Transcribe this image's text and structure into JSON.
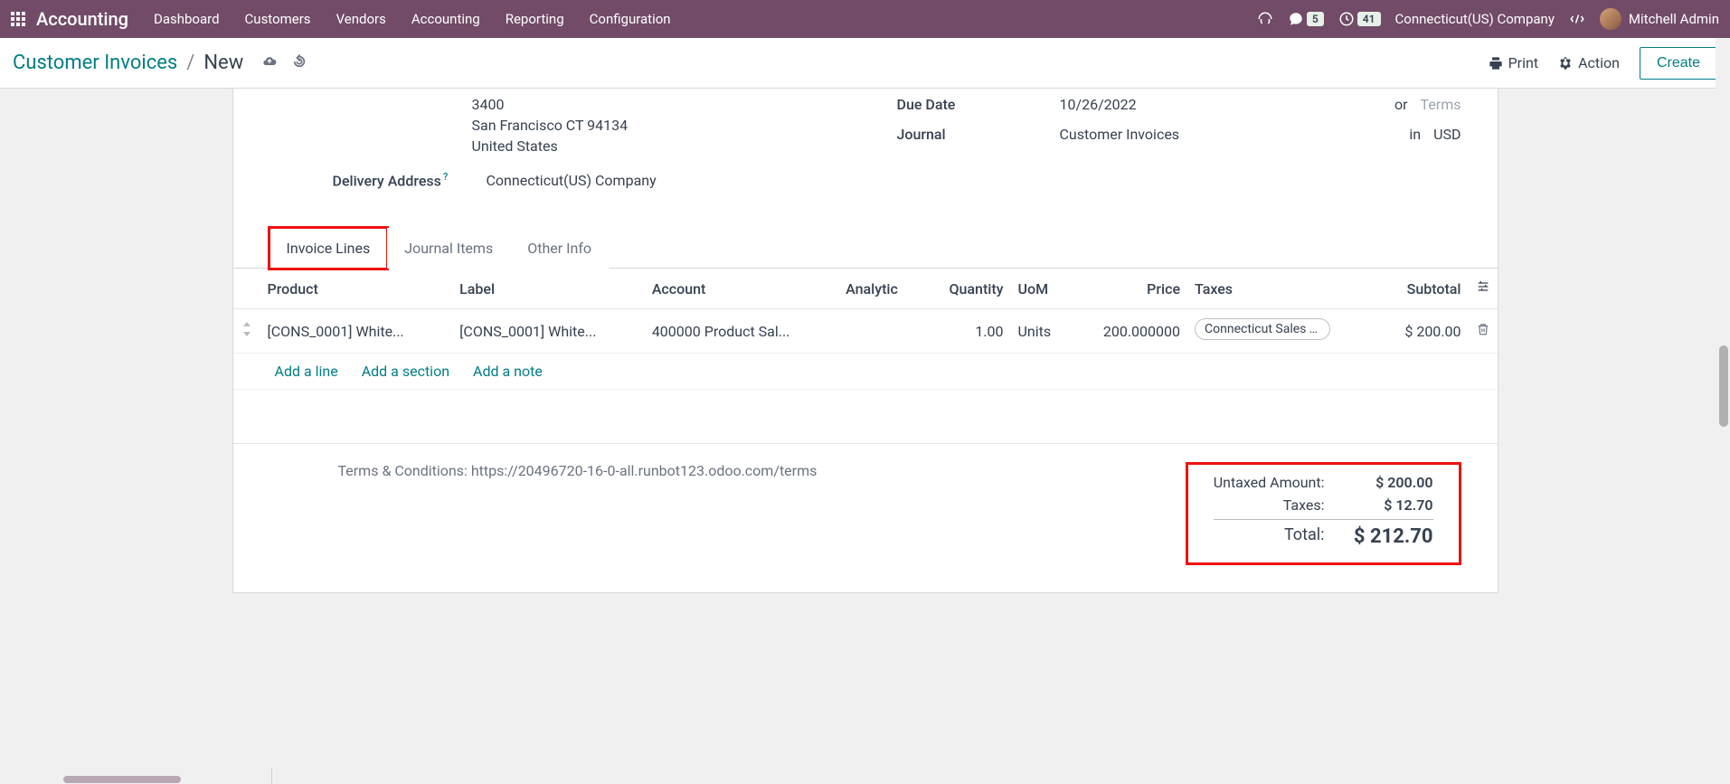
{
  "topbar": {
    "brand": "Accounting",
    "menu": [
      "Dashboard",
      "Customers",
      "Vendors",
      "Accounting",
      "Reporting",
      "Configuration"
    ],
    "msg_count": "5",
    "activity_count": "41",
    "company": "Connecticut(US) Company",
    "user": "Mitchell Admin"
  },
  "breadcrumb": {
    "root": "Customer Invoices",
    "current": "New",
    "print_label": "Print",
    "action_label": "Action",
    "create_label": "Create"
  },
  "form": {
    "address": {
      "line1": "3400",
      "line2": "San Francisco CT 94134",
      "line3": "United States"
    },
    "delivery_label": "Delivery Address",
    "delivery_value": "Connecticut(US) Company",
    "due_date_label": "Due Date",
    "due_date_value": "10/26/2022",
    "or_text": "or",
    "terms_placeholder": "Terms",
    "journal_label": "Journal",
    "journal_value": "Customer Invoices",
    "in_text": "in",
    "currency": "USD"
  },
  "tabs": [
    "Invoice Lines",
    "Journal Items",
    "Other Info"
  ],
  "table": {
    "headers": {
      "product": "Product",
      "label": "Label",
      "account": "Account",
      "analytic": "Analytic",
      "quantity": "Quantity",
      "uom": "UoM",
      "price": "Price",
      "taxes": "Taxes",
      "subtotal": "Subtotal"
    },
    "row": {
      "product": "[CONS_0001] White...",
      "label": "[CONS_0001] White...",
      "account": "400000 Product Sal...",
      "analytic": "",
      "quantity": "1.00",
      "uom": "Units",
      "price": "200.000000",
      "tax": "Connecticut Sales Tax (",
      "subtotal": "$ 200.00"
    },
    "add_line": "Add a line",
    "add_section": "Add a section",
    "add_note": "Add a note"
  },
  "footer": {
    "terms": "Terms & Conditions: https://20496720-16-0-all.runbot123.odoo.com/terms",
    "untaxed_label": "Untaxed Amount:",
    "untaxed_value": "$ 200.00",
    "taxes_label": "Taxes:",
    "taxes_value": "$ 12.70",
    "total_label": "Total:",
    "total_value": "$ 212.70"
  }
}
